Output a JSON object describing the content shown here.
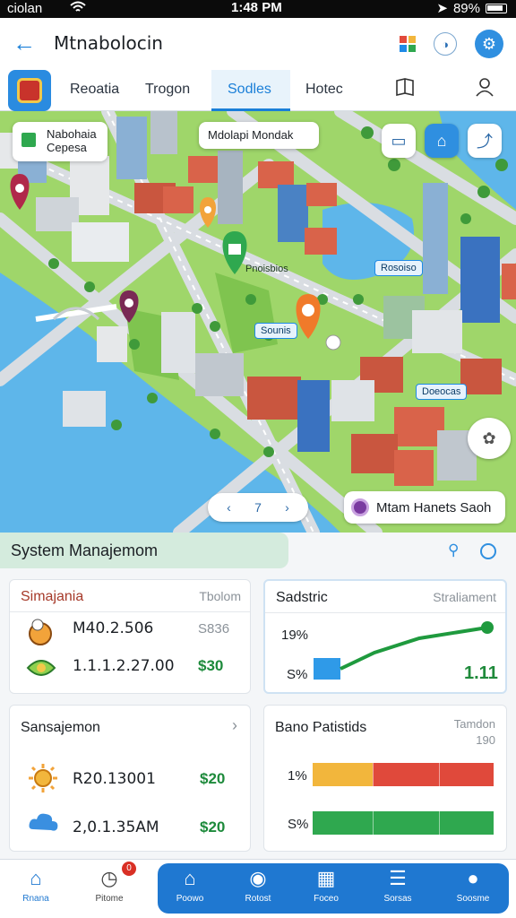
{
  "status_bar": {
    "carrier": "ciolan",
    "time": "1:48 PM",
    "battery": "89%"
  },
  "header": {
    "title": "Mtnabolocin"
  },
  "tabs": [
    {
      "label": "Reoatia"
    },
    {
      "label": "Trogon"
    },
    {
      "label": "Sodles",
      "active": true
    },
    {
      "label": "Hotec"
    }
  ],
  "map": {
    "callout_left": {
      "line1": "Nabohaia",
      "line2": "Cepesa"
    },
    "callout_top": "Mdolapi Mondak",
    "pins": {
      "p1": "Pnoisbios",
      "p2": "Rosoiso",
      "p3": "Sounis",
      "p4": "Doeocas"
    },
    "pager": {
      "prev": "‹",
      "page": "7",
      "next": "›"
    },
    "route_chip": "Mtam Hanets Saoh",
    "colors": {
      "water": "#5eb6ea",
      "park": "#9fd66a",
      "road": "#d9dde2",
      "accent": "#1e8ae6"
    }
  },
  "panel": {
    "title": "System Manajemom",
    "card1": {
      "title": "Simajania",
      "meta": "Tbolom",
      "rows": [
        {
          "text": "M40.2.506",
          "value": "S836"
        },
        {
          "text": "1.1.1.2.27.00",
          "value": "$30"
        }
      ]
    },
    "card2": {
      "title": "Sadstric",
      "meta": "Straliament",
      "y_top": "19%",
      "y_bottom": "S%",
      "value": "1.11"
    },
    "card3": {
      "title": "Sansajemon",
      "chevron": "›",
      "rows": [
        {
          "text": "R20.13001",
          "value": "$20"
        },
        {
          "text": "2,0.1.35AM",
          "value": "$20"
        }
      ]
    },
    "card4": {
      "title": "Bano Patistids",
      "meta_line1": "Tamdon",
      "meta_line2": "190",
      "bars": [
        {
          "label": "1%",
          "segments": [
            0.33,
            0.37,
            0.3
          ],
          "colors": [
            "#f2b63c",
            "#e0493b",
            "#e0493b"
          ]
        },
        {
          "label": "S%",
          "segments": [
            0.33,
            0.37,
            0.3
          ],
          "colors": [
            "#2fa84f",
            "#2fa84f",
            "#2fa84f"
          ]
        }
      ]
    }
  },
  "nav": [
    {
      "label": "Rnana",
      "icon": "home-icon"
    },
    {
      "label": "Pitome",
      "icon": "clock-icon",
      "badge": "0"
    },
    {
      "label": "Poowo",
      "icon": "home-icon"
    },
    {
      "label": "Rotost",
      "icon": "globe-icon"
    },
    {
      "label": "Foceo",
      "icon": "calendar-icon"
    },
    {
      "label": "Sorsas",
      "icon": "list-icon"
    },
    {
      "label": "Soosme",
      "icon": "user-icon"
    }
  ]
}
